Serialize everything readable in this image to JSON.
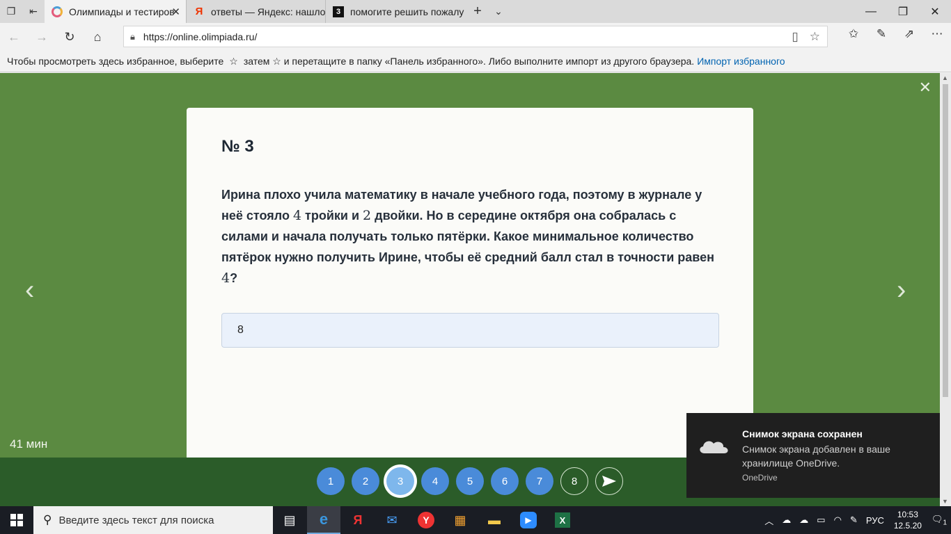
{
  "browser": {
    "tabs": [
      {
        "title": "Олимпиады и тестиров",
        "active": true
      },
      {
        "title": "ответы — Яндекс: нашлось",
        "active": false
      },
      {
        "title": "помогите решить пожалуй",
        "active": false
      }
    ],
    "url": "https://online.olimpiada.ru/",
    "favorites_bar": {
      "text_before": "Чтобы просмотреть здесь избранное, выберите",
      "text_middle": "затем ☆ и перетащите в папку «Панель избранного». Либо выполните импорт из другого браузера.",
      "link": "Импорт избранного"
    }
  },
  "task": {
    "number": "№ 3",
    "text_parts": [
      "Ирина плохо учила математику в начале учебного года, поэтому в журнале у неё стояло ",
      "4",
      " тройки и ",
      "2",
      " двойки. Но в середине октября она собралась с силами и начала получать только пятёрки. Какое минимальное количество пятёрок нужно получить Ирине, чтобы её средний балл стал в точности равен ",
      "4",
      "?"
    ],
    "answer": "8"
  },
  "timer": "41 мин",
  "question_nav": [
    {
      "label": "1",
      "state": "done"
    },
    {
      "label": "2",
      "state": "done"
    },
    {
      "label": "3",
      "state": "current"
    },
    {
      "label": "4",
      "state": "done"
    },
    {
      "label": "5",
      "state": "done"
    },
    {
      "label": "6",
      "state": "done"
    },
    {
      "label": "7",
      "state": "done"
    },
    {
      "label": "8",
      "state": "empty"
    }
  ],
  "toast": {
    "title": "Снимок экрана сохранен",
    "body": "Снимок экрана добавлен в ваше хранилище OneDrive.",
    "source": "OneDrive"
  },
  "taskbar": {
    "search_placeholder": "Введите здесь текст для поиска",
    "language": "РУС",
    "time": "10:53",
    "date": "12.5.20",
    "notifications": "1"
  },
  "colors": {
    "page_bg": "#5b8a41",
    "nav_strip": "#2b5c29",
    "question_done": "#4a8bd9",
    "question_current": "#7eb7ec"
  }
}
